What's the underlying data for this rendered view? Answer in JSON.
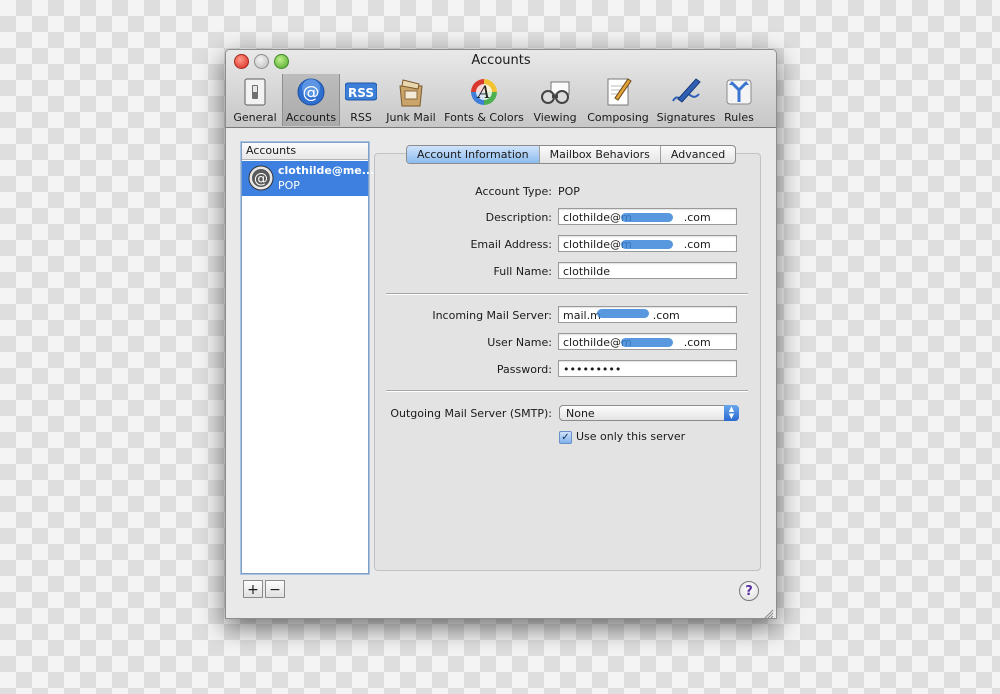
{
  "window": {
    "title": "Accounts"
  },
  "toolbar": {
    "items": [
      {
        "label": "General",
        "icon": "general-switch-icon"
      },
      {
        "label": "Accounts",
        "icon": "at-sign-icon",
        "selected": true
      },
      {
        "label": "RSS",
        "icon": "rss-icon",
        "icon_text": "RSS"
      },
      {
        "label": "Junk Mail",
        "icon": "junk-mail-icon"
      },
      {
        "label": "Fonts & Colors",
        "icon": "fonts-colors-icon"
      },
      {
        "label": "Viewing",
        "icon": "viewing-icon"
      },
      {
        "label": "Composing",
        "icon": "composing-icon"
      },
      {
        "label": "Signatures",
        "icon": "signatures-icon"
      },
      {
        "label": "Rules",
        "icon": "rules-icon"
      }
    ]
  },
  "sidebar": {
    "header": "Accounts",
    "accounts": [
      {
        "name": "clothilde@me...",
        "type": "POP",
        "selected": true
      }
    ],
    "add_label": "+",
    "remove_label": "−"
  },
  "tabs": [
    {
      "label": "Account Information",
      "active": true
    },
    {
      "label": "Mailbox Behaviors",
      "active": false
    },
    {
      "label": "Advanced",
      "active": false
    }
  ],
  "form": {
    "account_type": {
      "label": "Account Type:",
      "value": "POP"
    },
    "description": {
      "label": "Description:",
      "value_prefix": "clothilde@m",
      "value_suffix": ".com"
    },
    "email_address": {
      "label": "Email Address:",
      "value_prefix": "clothilde@m",
      "value_suffix": ".com"
    },
    "full_name": {
      "label": "Full Name:",
      "value": "clothilde"
    },
    "incoming_server": {
      "label": "Incoming Mail Server:",
      "value_prefix": "mail.m",
      "value_suffix": ".com"
    },
    "user_name": {
      "label": "User Name:",
      "value_prefix": "clothilde@m",
      "value_suffix": ".com"
    },
    "password": {
      "label": "Password:",
      "value": "•••••••••"
    },
    "outgoing_server": {
      "label": "Outgoing Mail Server (SMTP):",
      "value": "None"
    },
    "use_only_this_server": {
      "label": "Use only this server",
      "checked": true
    }
  },
  "help_label": "?",
  "colors": {
    "selection": "#3d80df",
    "tab_active": "#8cbcef",
    "redaction": "#3c86d8"
  }
}
